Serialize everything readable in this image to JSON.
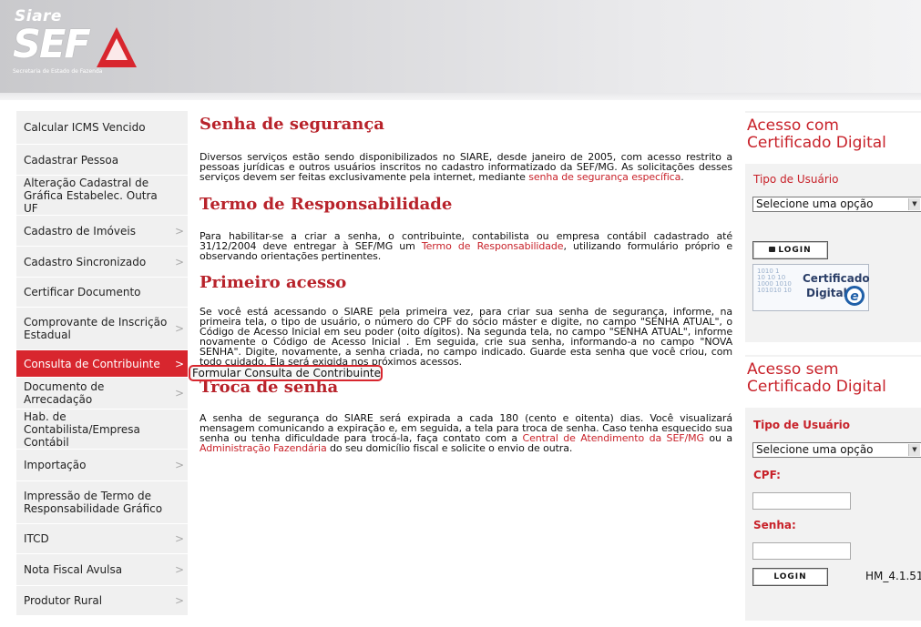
{
  "logo": {
    "siare": "Siare",
    "sef": "SEF",
    "subtitle": "Secretaria de Estado de Fazenda"
  },
  "sidebar": {
    "items": [
      {
        "label": "Calcular ICMS Vencido",
        "chevron": false
      },
      {
        "label": "Cadastrar Pessoa",
        "chevron": false
      },
      {
        "label": "Alteração Cadastral de Gráfica Estabelec. Outra UF",
        "chevron": false
      },
      {
        "label": "Cadastro de Imóveis",
        "chevron": true
      },
      {
        "label": "Cadastro Sincronizado",
        "chevron": true
      },
      {
        "label": "Certificar Documento",
        "chevron": false
      },
      {
        "label": "Comprovante de Inscrição Estadual",
        "chevron": true
      },
      {
        "label": "Consulta de Contribuinte",
        "chevron": true,
        "active": true
      },
      {
        "label": "Documento de Arrecadação",
        "chevron": true
      },
      {
        "label": "Hab. de Contabilista/Empresa Contábil",
        "chevron": false
      },
      {
        "label": "Importação",
        "chevron": true
      },
      {
        "label": "Impressão de Termo de Responsabilidade Gráfico",
        "chevron": false
      },
      {
        "label": "ITCD",
        "chevron": true
      },
      {
        "label": "Nota Fiscal Avulsa",
        "chevron": true
      },
      {
        "label": "Produtor Rural",
        "chevron": true
      }
    ],
    "chevron_glyph": ">"
  },
  "tooltip": {
    "label": "Formular Consulta de Contribuinte"
  },
  "content": {
    "s1_title": "Senha de segurança",
    "s1_text": "Diversos serviços estão sendo disponibilizados no SIARE, desde janeiro de 2005, com acesso restrito a pessoas jurídicas e outros usuários inscritos no cadastro informatizado da SEF/MG. As solicitações desses serviços devem ser feitas exclusivamente pela internet, mediante ",
    "s1_link": "senha de segurança específica",
    "s1_end": ".",
    "s2_title": "Termo de Responsabilidade",
    "s2_text": "Para habilitar-se a criar a senha, o contribuinte, contabilista ou empresa contábil cadastrado até 31/12/2004 deve entregar à SEF/MG um ",
    "s2_link": "Termo de Responsabilidade",
    "s2_end": ", utilizando formulário próprio e observando orientações pertinentes.",
    "s3_title": "Primeiro acesso",
    "s3_text": "Se você está acessando o SIARE pela primeira vez, para criar sua senha de segurança, informe, na primeira tela, o tipo de usuário, o número do CPF do sócio máster e digite, no campo \"SENHA ATUAL\", o Código de Acesso Inicial em seu poder (oito dígitos). Na segunda tela, no campo \"SENHA ATUAL\", informe novamente o Código de Acesso Inicial . Em seguida, crie sua senha, informando-a no campo \"NOVA SENHA\". Digite, novamente, a senha criada, no campo indicado. Guarde esta senha que você criou, com todo cuidado. Ela será exigida nos próximos acessos.",
    "s4_title": "Troca de senha",
    "s4_text": "A senha de segurança do SIARE será expirada a cada 180 (cento e oitenta) dias. Você visualizará mensagem comunicando a expiração e, em seguida, a tela para troca de senha. Caso tenha esquecido sua senha ou tenha dificuldade para trocá-la, faça contato com a ",
    "s4_link1": "Central de Atendimento da SEF/MG",
    "s4_mid": " ou a ",
    "s4_link2": "Administração Fazendária",
    "s4_end": " do seu domicílio fiscal e solicite o envio de outra."
  },
  "cert_panel": {
    "title": "Acesso com Certificado Digital",
    "user_type_label": "Tipo de Usuário",
    "select_value": "Selecione uma opção",
    "login_label": "LOGIN",
    "badge_line1": "Certificado",
    "badge_line2": "Digital",
    "badge_e": "e"
  },
  "nocert_panel": {
    "title": "Acesso sem Certificado Digital",
    "user_type_label": "Tipo de Usuário",
    "select_value": "Selecione uma opção",
    "cpf_label": "CPF:",
    "cpf_value": "",
    "password_label": "Senha:",
    "password_value": "",
    "login_label": "LOGIN"
  },
  "version": "HM_4.1.51",
  "colors": {
    "accent": "#c8222a",
    "active_menu": "#d8262e",
    "sidebar_bg": "#f0f0f0"
  }
}
